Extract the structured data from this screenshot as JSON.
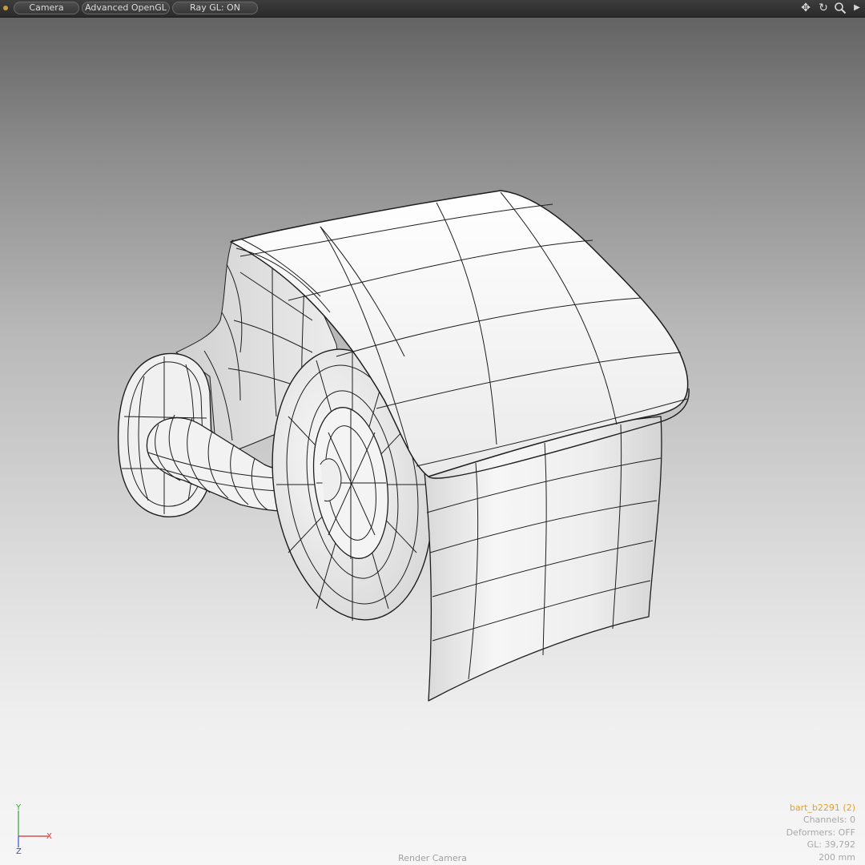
{
  "toolbar": {
    "buttons": [
      {
        "label": "Camera"
      },
      {
        "label": "Advanced OpenGL"
      },
      {
        "label": "Ray GL: ON"
      }
    ],
    "icons": [
      "move-view-icon",
      "rotate-view-icon",
      "zoom-view-icon",
      "expand-arrow-icon"
    ]
  },
  "scene": {
    "subject": "toilet paper holder wireframe",
    "shading": "white-solid-with-wireframe"
  },
  "axis": {
    "y": "Y",
    "x": "X",
    "z": "Z"
  },
  "info": {
    "selection": "bart_b2291 (2)",
    "channels": "Channels: 0",
    "deformers": "Deformers: OFF",
    "gl": "GL: 39,792",
    "scale": "200 mm"
  },
  "camera_label": "Render Camera",
  "colors": {
    "selection_text": "#e0a030",
    "axis_x": "#d03030",
    "axis_y": "#30a030",
    "axis_z": "#3050d0"
  }
}
